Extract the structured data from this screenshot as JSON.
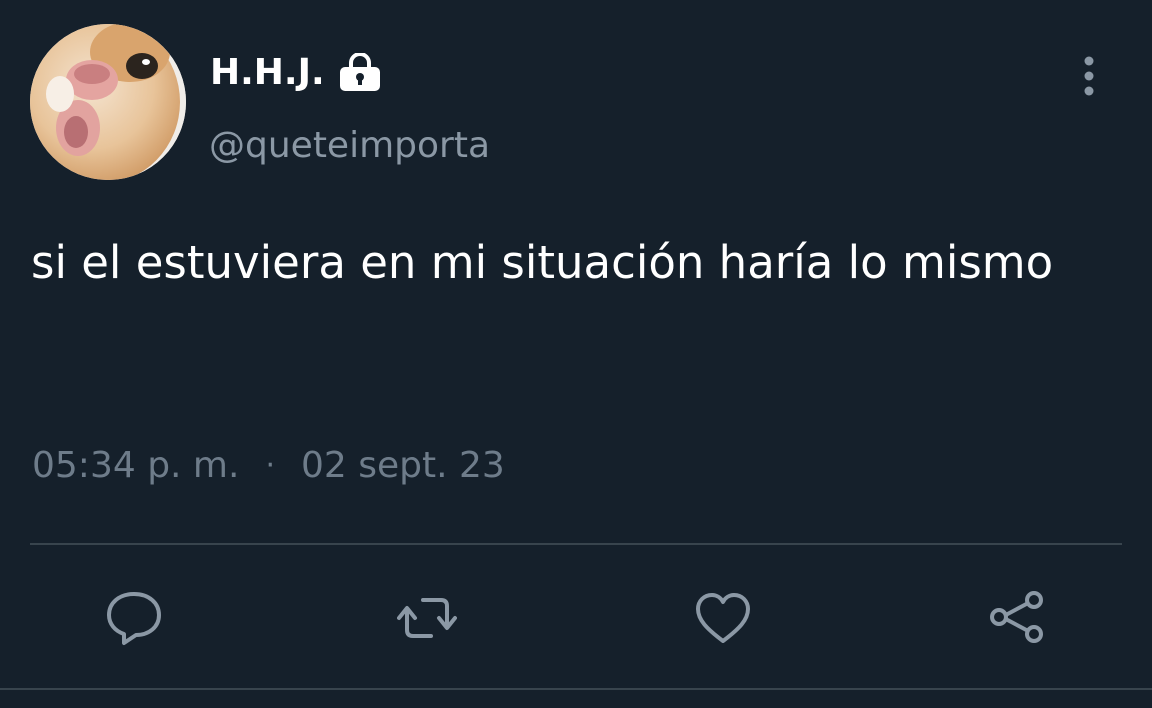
{
  "tweet": {
    "author": {
      "display_name": "H.H.J.",
      "handle": "@queteimporta",
      "protected_icon": "lock-icon",
      "avatar": "cat-photo"
    },
    "text": "si el estuviera en mi situación haría lo mismo",
    "time": "05:34 p. m.",
    "separator": "·",
    "date": "02 sept. 23"
  },
  "actions": [
    {
      "name": "reply",
      "icon": "reply-icon"
    },
    {
      "name": "retweet",
      "icon": "retweet-icon"
    },
    {
      "name": "like",
      "icon": "heart-icon"
    },
    {
      "name": "share",
      "icon": "share-icon"
    }
  ],
  "menu_icon": "more-vertical-icon",
  "colors": {
    "background": "#15202b",
    "primary_text": "#ffffff",
    "secondary_text": "#8b98a5",
    "timestamp_text": "#6e7c8a",
    "icon": "#8b98a5",
    "divider": "#38444d"
  }
}
